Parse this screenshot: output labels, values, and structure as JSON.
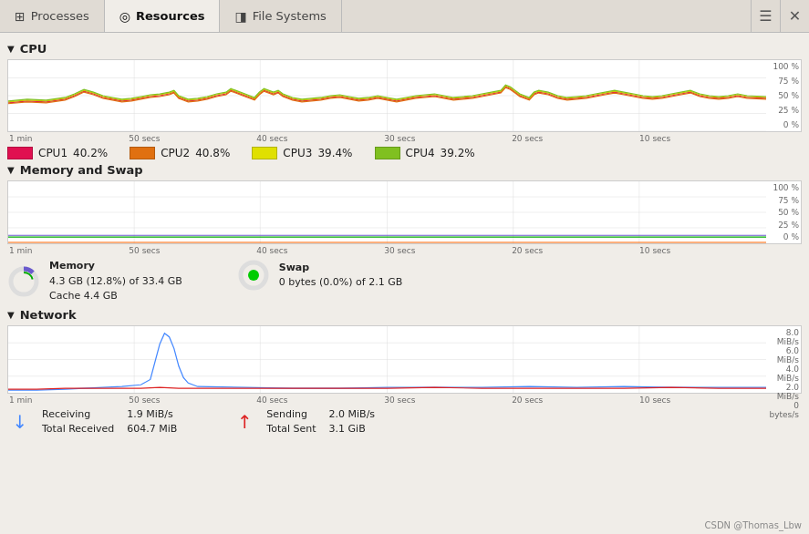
{
  "tabs": [
    {
      "label": "Processes",
      "icon": "⊞",
      "active": false
    },
    {
      "label": "Resources",
      "icon": "◎",
      "active": true
    },
    {
      "label": "File Systems",
      "icon": "◨",
      "active": false
    }
  ],
  "titlebar": {
    "menu_label": "☰",
    "close_label": "✕"
  },
  "sections": {
    "cpu": {
      "label": "CPU",
      "collapsed": false,
      "yaxis": [
        "100 %",
        "75 %",
        "50 %",
        "25 %",
        "0 %"
      ],
      "xaxis": [
        "1 min",
        "50 secs",
        "40 secs",
        "30 secs",
        "20 secs",
        "10 secs",
        ""
      ],
      "legend": [
        {
          "name": "CPU1",
          "value": "40.2%",
          "color": "#e01050"
        },
        {
          "name": "CPU2",
          "value": "40.8%",
          "color": "#e07010"
        },
        {
          "name": "CPU3",
          "value": "39.4%",
          "color": "#e0e000"
        },
        {
          "name": "CPU4",
          "value": "39.2%",
          "color": "#80c020"
        }
      ]
    },
    "memory": {
      "label": "Memory and Swap",
      "collapsed": false,
      "yaxis": [
        "100 %",
        "75 %",
        "50 %",
        "25 %",
        "0 %"
      ],
      "xaxis": [
        "1 min",
        "50 secs",
        "40 secs",
        "30 secs",
        "20 secs",
        "10 secs",
        ""
      ],
      "memory": {
        "label": "Memory",
        "line1": "4.3 GB (12.8%) of 33.4 GB",
        "line2": "Cache 4.4 GB"
      },
      "swap": {
        "label": "Swap",
        "line1": "0 bytes (0.0%) of 2.1 GB"
      }
    },
    "network": {
      "label": "Network",
      "collapsed": false,
      "yaxis": [
        "8.0 MiB/s",
        "6.0 MiB/s",
        "4.0 MiB/s",
        "2.0 MiB/s",
        "0 bytes/s"
      ],
      "xaxis": [
        "1 min",
        "50 secs",
        "40 secs",
        "30 secs",
        "20 secs",
        "10 secs",
        ""
      ],
      "receiving": {
        "label": "Receiving",
        "value": "1.9 MiB/s",
        "total_label": "Total Received",
        "total_value": "604.7 MiB"
      },
      "sending": {
        "label": "Sending",
        "value": "2.0 MiB/s",
        "total_label": "Total Sent",
        "total_value": "3.1 GiB"
      }
    }
  },
  "watermark": "CSDN @Thomas_Lbw"
}
